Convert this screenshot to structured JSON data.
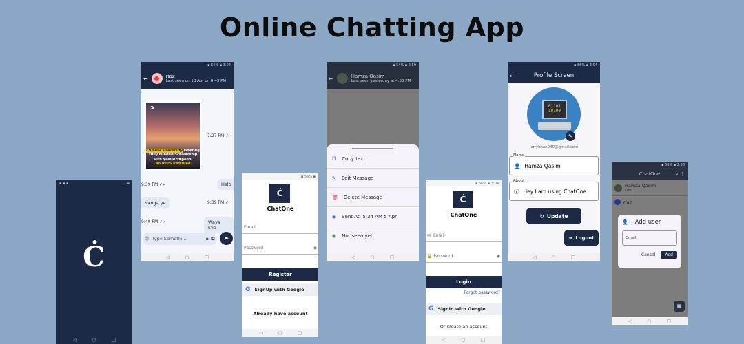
{
  "page": {
    "title": "Online Chatting App"
  },
  "splash": {},
  "chat": {
    "user_name": "riaz",
    "last_seen": "Last seen on 18 Apr on 9:43 PM",
    "image_caption_1": "Chinese University",
    "image_caption_2": "Offering",
    "image_caption_3": "Fully Funded Scholarship",
    "image_caption_4": "with $4000 Stipend,",
    "image_caption_5": "No IELTS Required",
    "msg_time_1": "7:27 PM",
    "msg_2": "Helo",
    "msg_2_time": "9:39 PM",
    "msg_3": "sanga ye",
    "msg_3_time": "9:39 PM",
    "msg_4": "Waya kna",
    "msg_4_time": "9:40 PM",
    "input_placeholder": "Type Somethi..."
  },
  "register": {
    "app_name": "ChatOne",
    "email_placeholder": "Email",
    "password_placeholder": "Password",
    "register_label": "Register",
    "google_label": "SignUp with Google",
    "account_link": "Already have account"
  },
  "msg_menu": {
    "user_name": "Hamza Qasim",
    "last_seen": "Last seen yesterday at 4:33 PM",
    "items": [
      "Copy text",
      "Edit Message",
      "Delete Message",
      "Sent At: 5:34 AM 5 Apr",
      "Not seen yet"
    ]
  },
  "login": {
    "app_name": "ChatOne",
    "email_placeholder": "Email",
    "password_placeholder": "Password",
    "login_label": "Login",
    "forgot_label": "Forgot password?",
    "google_label": "SignIn with Google",
    "create_link": "Or create an account"
  },
  "profile": {
    "title": "Profile Screen",
    "email": "jerrykhan940@gmail.com",
    "name_label": "Name",
    "name_value": "Hamza Qasim",
    "about_label": "About",
    "about_value": "Hey I am using ChatOne",
    "update_label": "Update",
    "logout_label": "Logout"
  },
  "home": {
    "title": "ChatOne",
    "contact_1_name": "Hamza Qasim",
    "contact_1_msg": "Dhu",
    "contact_2_name": "riaz",
    "dialog_title": "Add user",
    "dialog_placeholder": "Email",
    "cancel_label": "Cancel",
    "add_label": "Add"
  },
  "colors": {
    "background": "#8ba9c6",
    "primary": "#1c2a45"
  }
}
